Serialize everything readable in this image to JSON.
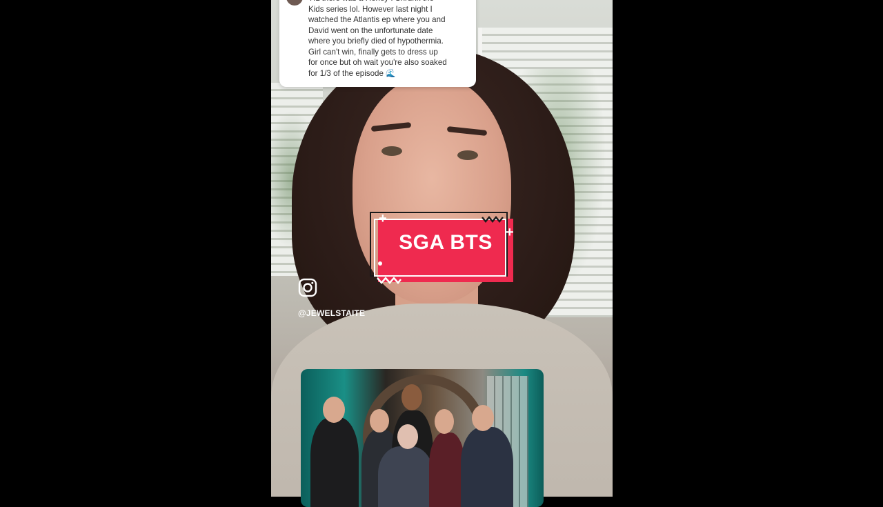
{
  "comment": {
    "text": "TIL there was a Honey I Shrunk the\nKids series lol. However last night I\nwatched the Atlantis ep where you and\nDavid went on the unfortunate date\nwhere you briefly died of hypothermia.\nGirl can't win, finally gets to dress up\nfor once but oh wait you're also soaked\nfor 1/3 of the episode 🌊"
  },
  "sticker": {
    "label": "SGA BTS"
  },
  "instagram": {
    "icon": "instagram-icon",
    "handle": "@JEWELSTAITE"
  },
  "colors": {
    "background": "#000000",
    "sticker_red": "#ef2a4f",
    "text_white": "#ffffff",
    "comment_bg": "#ffffff"
  }
}
